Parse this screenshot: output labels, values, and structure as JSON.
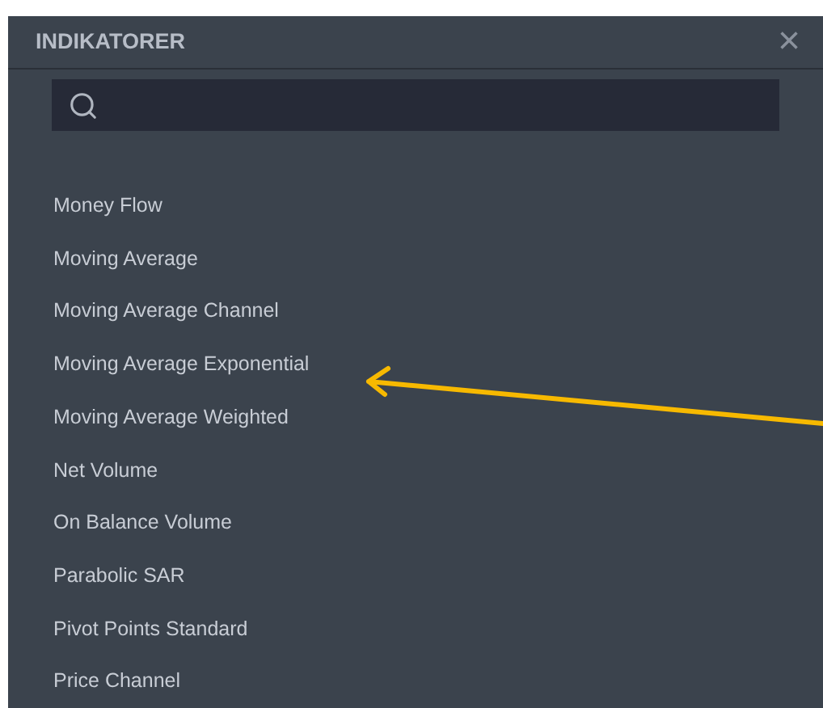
{
  "dialog": {
    "title": "INDIKATORER",
    "close": "×"
  },
  "indicators": [
    {
      "label": "Money Flow"
    },
    {
      "label": "Moving Average"
    },
    {
      "label": "Moving Average Channel"
    },
    {
      "label": "Moving Average Exponential"
    },
    {
      "label": "Moving Average Weighted"
    },
    {
      "label": "Net Volume"
    },
    {
      "label": "On Balance Volume"
    },
    {
      "label": "Parabolic SAR"
    },
    {
      "label": "Pivot Points Standard"
    },
    {
      "label": "Price Channel"
    }
  ]
}
